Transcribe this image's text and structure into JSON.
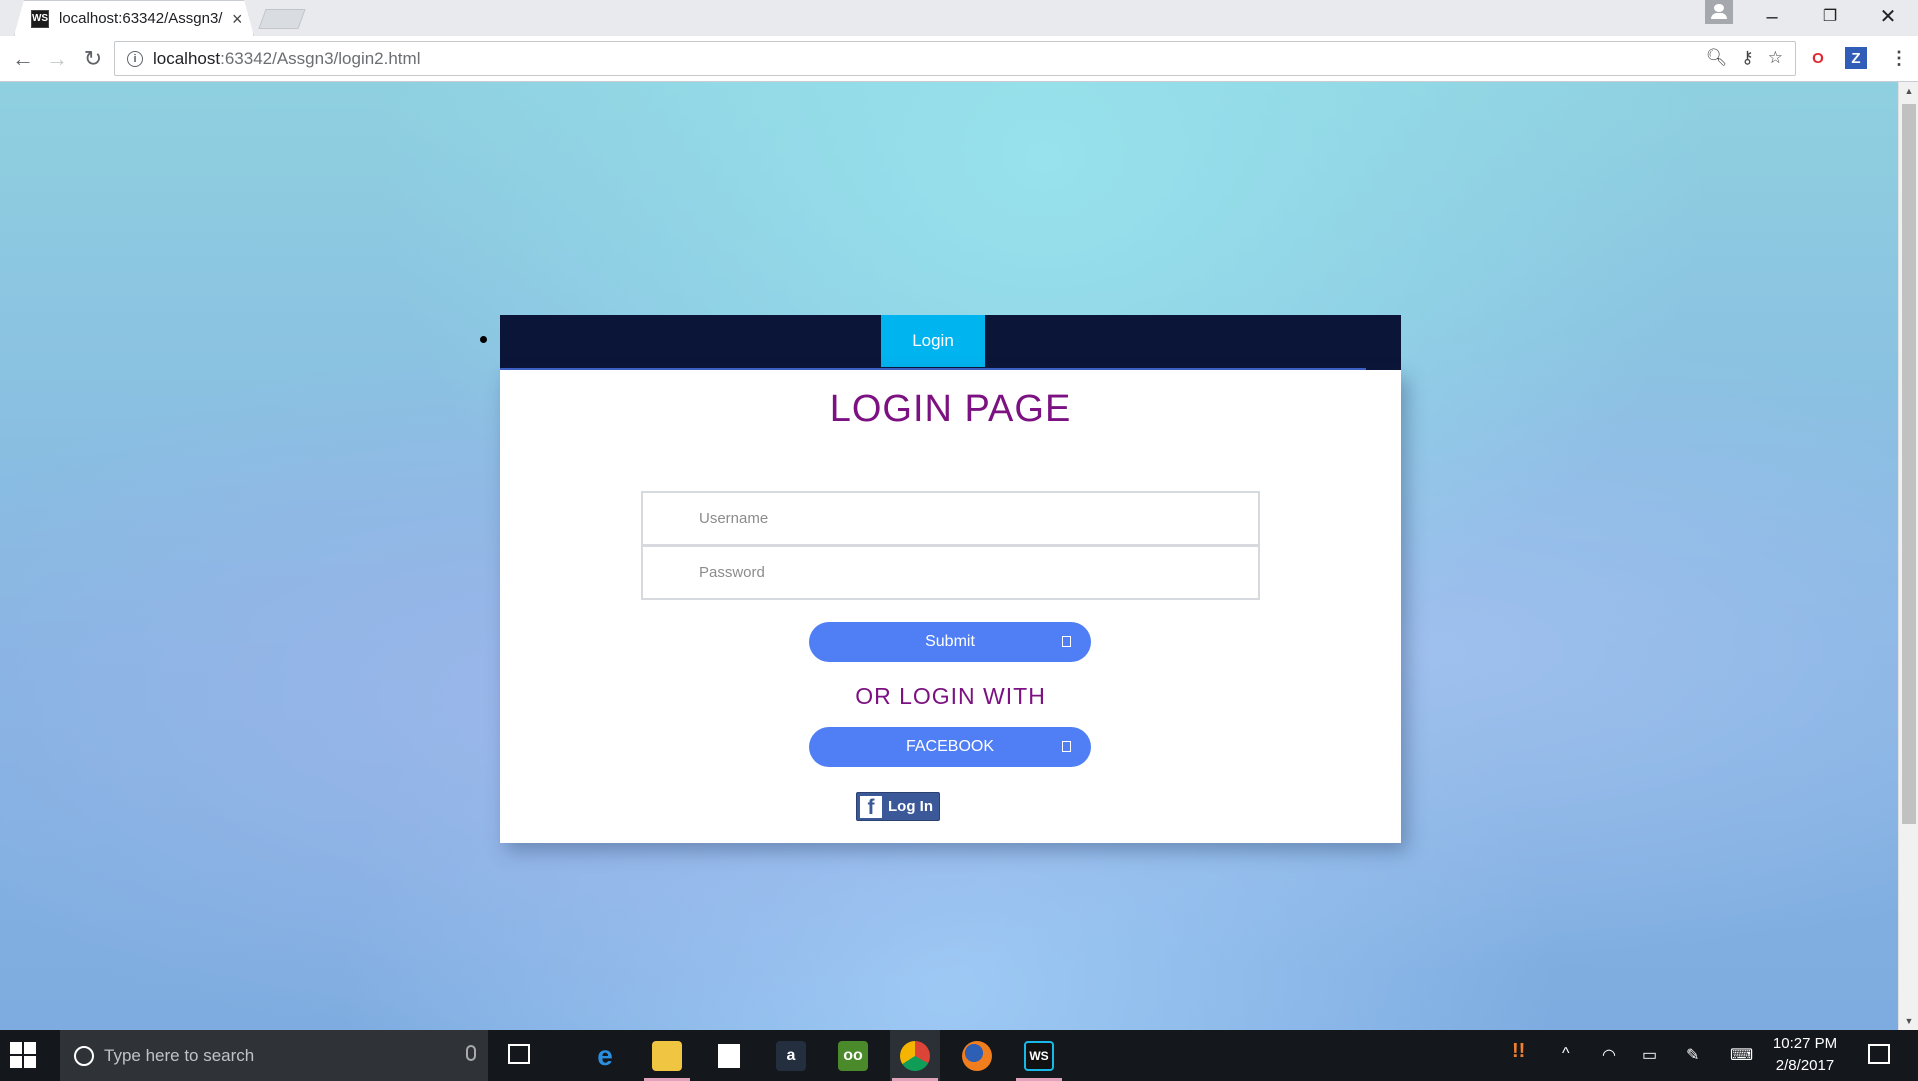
{
  "browser": {
    "tab_title": "localhost:63342/Assgn3/",
    "favicon_text": "WS",
    "tab_close": "×",
    "url_host": "localhost",
    "url_rest": ":63342/Assgn3/login2.html",
    "window_controls": [
      "–",
      "❐",
      "✕"
    ]
  },
  "nav": {
    "items": [
      {
        "label": "Login"
      }
    ]
  },
  "login": {
    "title": "LOGIN PAGE",
    "username_placeholder": "Username",
    "password_placeholder": "Password",
    "submit_label": "Submit",
    "or_text": "OR LOGIN WITH",
    "facebook_label": "FACEBOOK",
    "fb_login_label": "Log In"
  },
  "taskbar": {
    "search_placeholder": "Type here to search",
    "time": "10:27 PM",
    "date": "2/8/2017",
    "apps": [
      "edge-icon",
      "file-explorer-icon",
      "store-icon",
      "amazon-icon",
      "tripadvisor-icon",
      "chrome-icon",
      "firefox-icon",
      "webstorm-icon"
    ]
  },
  "colors": {
    "title_purple": "#7c1282",
    "navbar": "#0b1538",
    "nav_active": "#00b4ef",
    "button_blue": "#4f7ef5",
    "facebook": "#3b5998"
  }
}
